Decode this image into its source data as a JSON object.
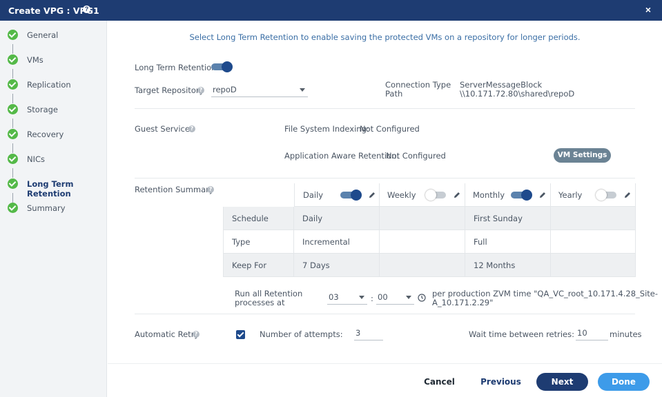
{
  "window": {
    "title": "Create VPG : VPG1",
    "help_glyph": "?",
    "close_glyph": "×"
  },
  "steps": [
    {
      "label": "General"
    },
    {
      "label": "VMs"
    },
    {
      "label": "Replication"
    },
    {
      "label": "Storage"
    },
    {
      "label": "Recovery"
    },
    {
      "label": "NICs"
    },
    {
      "label": "Long Term Retention"
    },
    {
      "label": "Summary"
    }
  ],
  "intro": "Select Long Term Retention to enable saving the protected VMs on a repository for longer periods.",
  "ltr": {
    "label": "Long Term Retention",
    "enabled": true,
    "target_repository_label": "Target Repository",
    "target_repository_value": "repoD",
    "connection_type_label": "Connection Type",
    "connection_type_value": "ServerMessageBlock",
    "path_label": "Path",
    "path_value": "\\\\10.171.72.80\\shared\\repoD"
  },
  "guest": {
    "label": "Guest Services",
    "fsi_label": "File System Indexing:",
    "fsi_value": "Not Configured",
    "aar_label": "Application Aware Retention:",
    "aar_value": "Not Configured",
    "vm_settings_button": "VM Settings"
  },
  "retention": {
    "label": "Retention Summary",
    "columns": [
      {
        "name": "Daily",
        "enabled": true
      },
      {
        "name": "Weekly",
        "enabled": false
      },
      {
        "name": "Monthly",
        "enabled": true
      },
      {
        "name": "Yearly",
        "enabled": false
      }
    ],
    "rows": [
      {
        "label": "Schedule",
        "cells": [
          "Daily",
          "",
          "First Sunday",
          ""
        ]
      },
      {
        "label": "Type",
        "cells": [
          "Incremental",
          "",
          "Full",
          ""
        ]
      },
      {
        "label": "Keep For",
        "cells": [
          "7 Days",
          "",
          "12 Months",
          ""
        ]
      }
    ],
    "run_label_line1": "Run all Retention",
    "run_label_line2": "processes at",
    "hour": "03",
    "separator": ":",
    "minute": "00",
    "zvm_line1": "per production ZVM time \"QA_VC_root_10.171.4.28_Site-",
    "zvm_line2": "A_10.171.2.29\""
  },
  "retry": {
    "label": "Automatic Retry",
    "checked": true,
    "attempts_label": "Number of attempts:",
    "attempts_value": "3",
    "wait_label": "Wait time between retries:",
    "wait_value": "10",
    "wait_unit": "minutes"
  },
  "footer": {
    "cancel": "Cancel",
    "previous": "Previous",
    "next": "Next",
    "done": "Done"
  },
  "colors": {
    "header": "#1e3c72",
    "accent": "#3d9be9",
    "success": "#54b948",
    "toggle_on": "#1e4a8c"
  }
}
